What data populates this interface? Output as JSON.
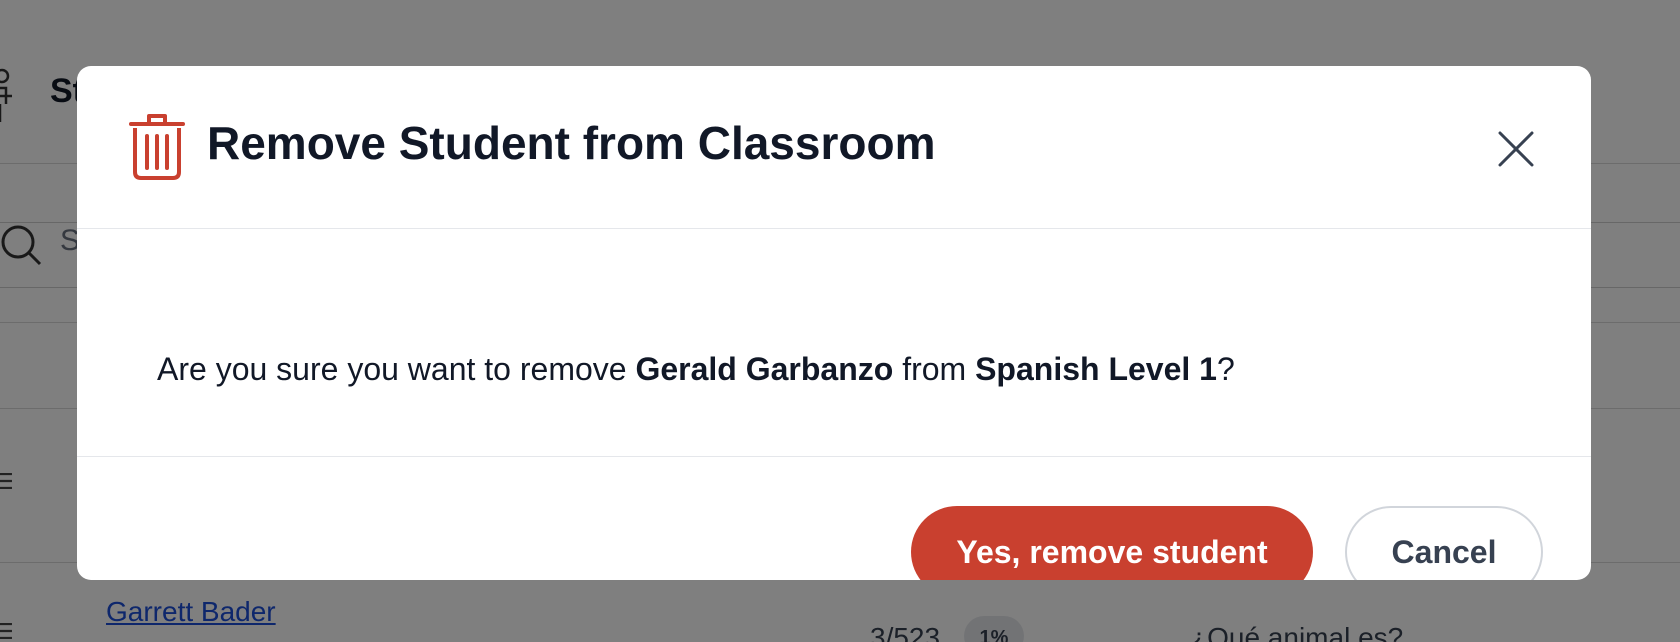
{
  "background": {
    "page_title_partial": "St",
    "search_placeholder_partial": "S",
    "student_link": "Garrett Bader",
    "progress_count": "3/523",
    "progress_percent": "1%",
    "last_question": "¿Qué animal es?"
  },
  "modal": {
    "title": "Remove Student from Classroom",
    "title_icon": "trash-icon",
    "close_icon": "close-icon",
    "message": {
      "prefix": "Are you sure you want to remove ",
      "student_name": "Gerald Garbanzo",
      "middle": " from ",
      "classroom_name": "Spanish Level 1",
      "suffix": "?"
    },
    "confirm_label": "Yes, remove student",
    "cancel_label": "Cancel"
  },
  "colors": {
    "danger": "#c9402f",
    "overlay": "rgba(0,0,0,0.5)",
    "text": "#111827",
    "link": "#1d4ed8"
  }
}
